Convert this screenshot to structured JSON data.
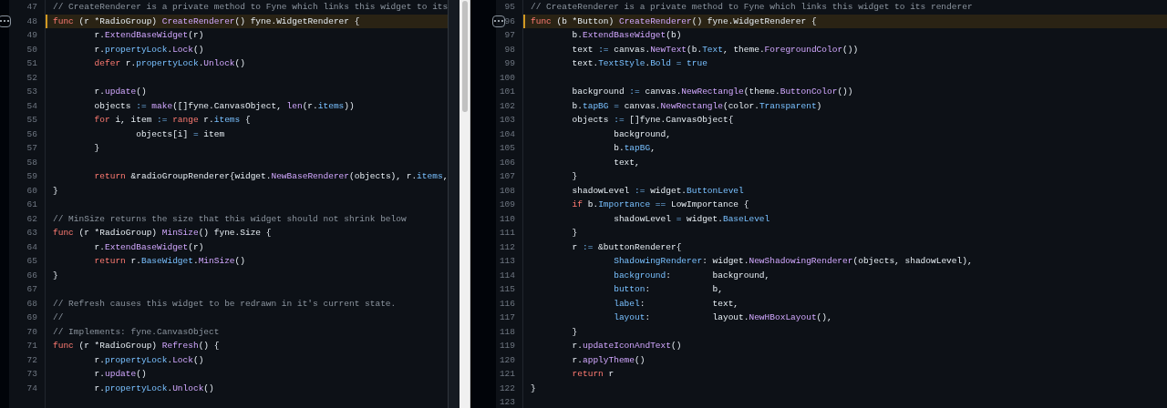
{
  "panes": [
    {
      "lines": [
        {
          "n": "47",
          "highlighted": false,
          "tokens": [
            {
              "kind": "comment",
              "text": "// CreateRenderer is a private method to Fyne which links this widget to its"
            }
          ]
        },
        {
          "n": "48",
          "highlighted": true,
          "tokens": [
            {
              "kind": "keyword",
              "text": "func"
            },
            {
              "kind": "plain",
              "text": " (r *RadioGroup) "
            },
            {
              "kind": "function",
              "text": "CreateRenderer"
            },
            {
              "kind": "plain",
              "text": "() fyne.WidgetRenderer {"
            }
          ]
        },
        {
          "n": "49",
          "highlighted": false,
          "tokens": [
            {
              "kind": "plain",
              "text": "\tr."
            },
            {
              "kind": "function",
              "text": "ExtendBaseWidget"
            },
            {
              "kind": "plain",
              "text": "(r)"
            }
          ]
        },
        {
          "n": "50",
          "highlighted": false,
          "tokens": [
            {
              "kind": "plain",
              "text": "\tr."
            },
            {
              "kind": "property",
              "text": "propertyLock"
            },
            {
              "kind": "plain",
              "text": "."
            },
            {
              "kind": "function",
              "text": "Lock"
            },
            {
              "kind": "plain",
              "text": "()"
            }
          ]
        },
        {
          "n": "51",
          "highlighted": false,
          "tokens": [
            {
              "kind": "keyword",
              "text": "\tdefer"
            },
            {
              "kind": "plain",
              "text": " r."
            },
            {
              "kind": "property",
              "text": "propertyLock"
            },
            {
              "kind": "plain",
              "text": "."
            },
            {
              "kind": "function",
              "text": "Unlock"
            },
            {
              "kind": "plain",
              "text": "()"
            }
          ]
        },
        {
          "n": "52",
          "highlighted": false
        },
        {
          "n": "53",
          "highlighted": false,
          "tokens": [
            {
              "kind": "plain",
              "text": "\tr."
            },
            {
              "kind": "function",
              "text": "update"
            },
            {
              "kind": "plain",
              "text": "()"
            }
          ]
        },
        {
          "n": "54",
          "highlighted": false,
          "tokens": [
            {
              "kind": "plain",
              "text": "\tobjects "
            },
            {
              "kind": "operator",
              "text": ":="
            },
            {
              "kind": "function",
              "text": " make"
            },
            {
              "kind": "plain",
              "text": "([]fyne.CanvasObject, "
            },
            {
              "kind": "function",
              "text": "len"
            },
            {
              "kind": "plain",
              "text": "(r."
            },
            {
              "kind": "property",
              "text": "items"
            },
            {
              "kind": "plain",
              "text": "))"
            }
          ]
        },
        {
          "n": "55",
          "highlighted": false,
          "tokens": [
            {
              "kind": "keyword",
              "text": "\tfor"
            },
            {
              "kind": "plain",
              "text": " i, item "
            },
            {
              "kind": "operator",
              "text": ":="
            },
            {
              "kind": "keyword",
              "text": " range"
            },
            {
              "kind": "plain",
              "text": " r."
            },
            {
              "kind": "property",
              "text": "items"
            },
            {
              "kind": "plain",
              "text": " {"
            }
          ]
        },
        {
          "n": "56",
          "highlighted": false,
          "tokens": [
            {
              "kind": "plain",
              "text": "\t\tobjects[i] "
            },
            {
              "kind": "operator",
              "text": "="
            },
            {
              "kind": "plain",
              "text": " item"
            }
          ]
        },
        {
          "n": "57",
          "highlighted": false,
          "tokens": [
            {
              "kind": "plain",
              "text": "\t}"
            }
          ]
        },
        {
          "n": "58",
          "highlighted": false
        },
        {
          "n": "59",
          "highlighted": false,
          "tokens": [
            {
              "kind": "keyword",
              "text": "\treturn"
            },
            {
              "kind": "plain",
              "text": " &radioGroupRenderer{widget."
            },
            {
              "kind": "function",
              "text": "NewBaseRenderer"
            },
            {
              "kind": "plain",
              "text": "(objects), r."
            },
            {
              "kind": "property",
              "text": "items"
            },
            {
              "kind": "plain",
              "text": ","
            }
          ]
        },
        {
          "n": "60",
          "highlighted": false,
          "tokens": [
            {
              "kind": "plain",
              "text": "}"
            }
          ]
        },
        {
          "n": "61",
          "highlighted": false
        },
        {
          "n": "62",
          "highlighted": false,
          "tokens": [
            {
              "kind": "comment",
              "text": "// MinSize returns the size that this widget should not shrink below"
            }
          ]
        },
        {
          "n": "63",
          "highlighted": false,
          "tokens": [
            {
              "kind": "keyword",
              "text": "func"
            },
            {
              "kind": "plain",
              "text": " (r *RadioGroup) "
            },
            {
              "kind": "function",
              "text": "MinSize"
            },
            {
              "kind": "plain",
              "text": "() fyne.Size {"
            }
          ]
        },
        {
          "n": "64",
          "highlighted": false,
          "tokens": [
            {
              "kind": "plain",
              "text": "\tr."
            },
            {
              "kind": "function",
              "text": "ExtendBaseWidget"
            },
            {
              "kind": "plain",
              "text": "(r)"
            }
          ]
        },
        {
          "n": "65",
          "highlighted": false,
          "tokens": [
            {
              "kind": "keyword",
              "text": "\treturn"
            },
            {
              "kind": "plain",
              "text": " r."
            },
            {
              "kind": "property",
              "text": "BaseWidget"
            },
            {
              "kind": "plain",
              "text": "."
            },
            {
              "kind": "function",
              "text": "MinSize"
            },
            {
              "kind": "plain",
              "text": "()"
            }
          ]
        },
        {
          "n": "66",
          "highlighted": false,
          "tokens": [
            {
              "kind": "plain",
              "text": "}"
            }
          ]
        },
        {
          "n": "67",
          "highlighted": false
        },
        {
          "n": "68",
          "highlighted": false,
          "tokens": [
            {
              "kind": "comment",
              "text": "// Refresh causes this widget to be redrawn in it's current state."
            }
          ]
        },
        {
          "n": "69",
          "highlighted": false,
          "tokens": [
            {
              "kind": "comment",
              "text": "//"
            }
          ]
        },
        {
          "n": "70",
          "highlighted": false,
          "tokens": [
            {
              "kind": "comment",
              "text": "// Implements: fyne.CanvasObject"
            }
          ]
        },
        {
          "n": "71",
          "highlighted": false,
          "tokens": [
            {
              "kind": "keyword",
              "text": "func"
            },
            {
              "kind": "plain",
              "text": " (r *RadioGroup) "
            },
            {
              "kind": "function",
              "text": "Refresh"
            },
            {
              "kind": "plain",
              "text": "() {"
            }
          ]
        },
        {
          "n": "72",
          "highlighted": false,
          "tokens": [
            {
              "kind": "plain",
              "text": "\tr."
            },
            {
              "kind": "property",
              "text": "propertyLock"
            },
            {
              "kind": "plain",
              "text": "."
            },
            {
              "kind": "function",
              "text": "Lock"
            },
            {
              "kind": "plain",
              "text": "()"
            }
          ]
        },
        {
          "n": "73",
          "highlighted": false,
          "tokens": [
            {
              "kind": "plain",
              "text": "\tr."
            },
            {
              "kind": "function",
              "text": "update"
            },
            {
              "kind": "plain",
              "text": "()"
            }
          ]
        },
        {
          "n": "74",
          "highlighted": false,
          "tokens": [
            {
              "kind": "plain",
              "text": "\tr."
            },
            {
              "kind": "property",
              "text": "propertyLock"
            },
            {
              "kind": "plain",
              "text": "."
            },
            {
              "kind": "function",
              "text": "Unlock"
            },
            {
              "kind": "plain",
              "text": "()"
            }
          ]
        }
      ]
    },
    {
      "lines": [
        {
          "n": "95",
          "highlighted": false,
          "tokens": [
            {
              "kind": "comment",
              "text": "// CreateRenderer is a private method to Fyne which links this widget to its renderer"
            }
          ]
        },
        {
          "n": "96",
          "highlighted": true,
          "tokens": [
            {
              "kind": "keyword",
              "text": "func"
            },
            {
              "kind": "plain",
              "text": " (b *Button) "
            },
            {
              "kind": "function",
              "text": "CreateRenderer"
            },
            {
              "kind": "plain",
              "text": "() fyne.WidgetRenderer {"
            }
          ]
        },
        {
          "n": "97",
          "highlighted": false,
          "tokens": [
            {
              "kind": "plain",
              "text": "\tb."
            },
            {
              "kind": "function",
              "text": "ExtendBaseWidget"
            },
            {
              "kind": "plain",
              "text": "(b)"
            }
          ]
        },
        {
          "n": "98",
          "highlighted": false,
          "tokens": [
            {
              "kind": "plain",
              "text": "\ttext "
            },
            {
              "kind": "operator",
              "text": ":="
            },
            {
              "kind": "plain",
              "text": " canvas."
            },
            {
              "kind": "function",
              "text": "NewText"
            },
            {
              "kind": "plain",
              "text": "(b."
            },
            {
              "kind": "property",
              "text": "Text"
            },
            {
              "kind": "plain",
              "text": ", theme."
            },
            {
              "kind": "function",
              "text": "ForegroundColor"
            },
            {
              "kind": "plain",
              "text": "())"
            }
          ]
        },
        {
          "n": "99",
          "highlighted": false,
          "tokens": [
            {
              "kind": "plain",
              "text": "\ttext."
            },
            {
              "kind": "property",
              "text": "TextStyle"
            },
            {
              "kind": "plain",
              "text": "."
            },
            {
              "kind": "property",
              "text": "Bold"
            },
            {
              "kind": "operator",
              "text": " ="
            },
            {
              "kind": "property",
              "text": " true"
            }
          ]
        },
        {
          "n": "100",
          "highlighted": false
        },
        {
          "n": "101",
          "highlighted": false,
          "tokens": [
            {
              "kind": "plain",
              "text": "\tbackground "
            },
            {
              "kind": "operator",
              "text": ":="
            },
            {
              "kind": "plain",
              "text": " canvas."
            },
            {
              "kind": "function",
              "text": "NewRectangle"
            },
            {
              "kind": "plain",
              "text": "(theme."
            },
            {
              "kind": "function",
              "text": "ButtonColor"
            },
            {
              "kind": "plain",
              "text": "())"
            }
          ]
        },
        {
          "n": "102",
          "highlighted": false,
          "tokens": [
            {
              "kind": "plain",
              "text": "\tb."
            },
            {
              "kind": "property",
              "text": "tapBG"
            },
            {
              "kind": "operator",
              "text": " ="
            },
            {
              "kind": "plain",
              "text": " canvas."
            },
            {
              "kind": "function",
              "text": "NewRectangle"
            },
            {
              "kind": "plain",
              "text": "(color."
            },
            {
              "kind": "property",
              "text": "Transparent"
            },
            {
              "kind": "plain",
              "text": ")"
            }
          ]
        },
        {
          "n": "103",
          "highlighted": false,
          "tokens": [
            {
              "kind": "plain",
              "text": "\tobjects "
            },
            {
              "kind": "operator",
              "text": ":="
            },
            {
              "kind": "plain",
              "text": " []fyne.CanvasObject{"
            }
          ]
        },
        {
          "n": "104",
          "highlighted": false,
          "tokens": [
            {
              "kind": "plain",
              "text": "\t\tbackground,"
            }
          ]
        },
        {
          "n": "105",
          "highlighted": false,
          "tokens": [
            {
              "kind": "plain",
              "text": "\t\tb."
            },
            {
              "kind": "property",
              "text": "tapBG"
            },
            {
              "kind": "plain",
              "text": ","
            }
          ]
        },
        {
          "n": "106",
          "highlighted": false,
          "tokens": [
            {
              "kind": "plain",
              "text": "\t\ttext,"
            }
          ]
        },
        {
          "n": "107",
          "highlighted": false,
          "tokens": [
            {
              "kind": "plain",
              "text": "\t}"
            }
          ]
        },
        {
          "n": "108",
          "highlighted": false,
          "tokens": [
            {
              "kind": "plain",
              "text": "\tshadowLevel "
            },
            {
              "kind": "operator",
              "text": ":="
            },
            {
              "kind": "plain",
              "text": " widget."
            },
            {
              "kind": "property",
              "text": "ButtonLevel"
            }
          ]
        },
        {
          "n": "109",
          "highlighted": false,
          "tokens": [
            {
              "kind": "keyword",
              "text": "\tif"
            },
            {
              "kind": "plain",
              "text": " b."
            },
            {
              "kind": "property",
              "text": "Importance"
            },
            {
              "kind": "operator",
              "text": " =="
            },
            {
              "kind": "plain",
              "text": " LowImportance {"
            }
          ]
        },
        {
          "n": "110",
          "highlighted": false,
          "tokens": [
            {
              "kind": "plain",
              "text": "\t\tshadowLevel "
            },
            {
              "kind": "operator",
              "text": "="
            },
            {
              "kind": "plain",
              "text": " widget."
            },
            {
              "kind": "property",
              "text": "BaseLevel"
            }
          ]
        },
        {
          "n": "111",
          "highlighted": false,
          "tokens": [
            {
              "kind": "plain",
              "text": "\t}"
            }
          ]
        },
        {
          "n": "112",
          "highlighted": false,
          "tokens": [
            {
              "kind": "plain",
              "text": "\tr "
            },
            {
              "kind": "operator",
              "text": ":="
            },
            {
              "kind": "plain",
              "text": " &buttonRenderer{"
            }
          ]
        },
        {
          "n": "113",
          "highlighted": false,
          "tokens": [
            {
              "kind": "property",
              "text": "\t\tShadowingRenderer"
            },
            {
              "kind": "plain",
              "text": ": widget."
            },
            {
              "kind": "function",
              "text": "NewShadowingRenderer"
            },
            {
              "kind": "plain",
              "text": "(objects, shadowLevel),"
            }
          ]
        },
        {
          "n": "114",
          "highlighted": false,
          "tokens": [
            {
              "kind": "property",
              "text": "\t\tbackground"
            },
            {
              "kind": "plain",
              "text": ":        background,"
            }
          ]
        },
        {
          "n": "115",
          "highlighted": false,
          "tokens": [
            {
              "kind": "property",
              "text": "\t\tbutton"
            },
            {
              "kind": "plain",
              "text": ":            b,"
            }
          ]
        },
        {
          "n": "116",
          "highlighted": false,
          "tokens": [
            {
              "kind": "property",
              "text": "\t\tlabel"
            },
            {
              "kind": "plain",
              "text": ":             text,"
            }
          ]
        },
        {
          "n": "117",
          "highlighted": false,
          "tokens": [
            {
              "kind": "property",
              "text": "\t\tlayout"
            },
            {
              "kind": "plain",
              "text": ":            layout."
            },
            {
              "kind": "function",
              "text": "NewHBoxLayout"
            },
            {
              "kind": "plain",
              "text": "(),"
            }
          ]
        },
        {
          "n": "118",
          "highlighted": false,
          "tokens": [
            {
              "kind": "plain",
              "text": "\t}"
            }
          ]
        },
        {
          "n": "119",
          "highlighted": false,
          "tokens": [
            {
              "kind": "plain",
              "text": "\tr."
            },
            {
              "kind": "function",
              "text": "updateIconAndText"
            },
            {
              "kind": "plain",
              "text": "()"
            }
          ]
        },
        {
          "n": "120",
          "highlighted": false,
          "tokens": [
            {
              "kind": "plain",
              "text": "\tr."
            },
            {
              "kind": "function",
              "text": "applyTheme"
            },
            {
              "kind": "plain",
              "text": "()"
            }
          ]
        },
        {
          "n": "121",
          "highlighted": false,
          "tokens": [
            {
              "kind": "keyword",
              "text": "\treturn"
            },
            {
              "kind": "plain",
              "text": " r"
            }
          ]
        },
        {
          "n": "122",
          "highlighted": false,
          "tokens": [
            {
              "kind": "plain",
              "text": "}"
            }
          ]
        },
        {
          "n": "123",
          "highlighted": false
        }
      ]
    }
  ]
}
